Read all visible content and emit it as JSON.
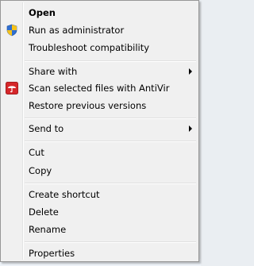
{
  "menu": {
    "open": "Open",
    "run_as_admin": "Run as administrator",
    "troubleshoot": "Troubleshoot compatibility",
    "share_with": "Share with",
    "scan_antivir": "Scan selected files with AntiVir",
    "restore_versions": "Restore previous versions",
    "send_to": "Send to",
    "cut": "Cut",
    "copy": "Copy",
    "create_shortcut": "Create shortcut",
    "delete": "Delete",
    "rename": "Rename",
    "properties": "Properties"
  },
  "icons": {
    "run_as_admin": "uac-shield-icon",
    "scan_antivir": "antivir-umbrella-icon",
    "submenu": "chevron-right-icon"
  },
  "colors": {
    "menu_background": "#f0f0f0",
    "menu_border": "#979797",
    "antivir_red": "#d5272a",
    "shield_blue": "#2f6fd0",
    "shield_yellow": "#f6c21a"
  }
}
